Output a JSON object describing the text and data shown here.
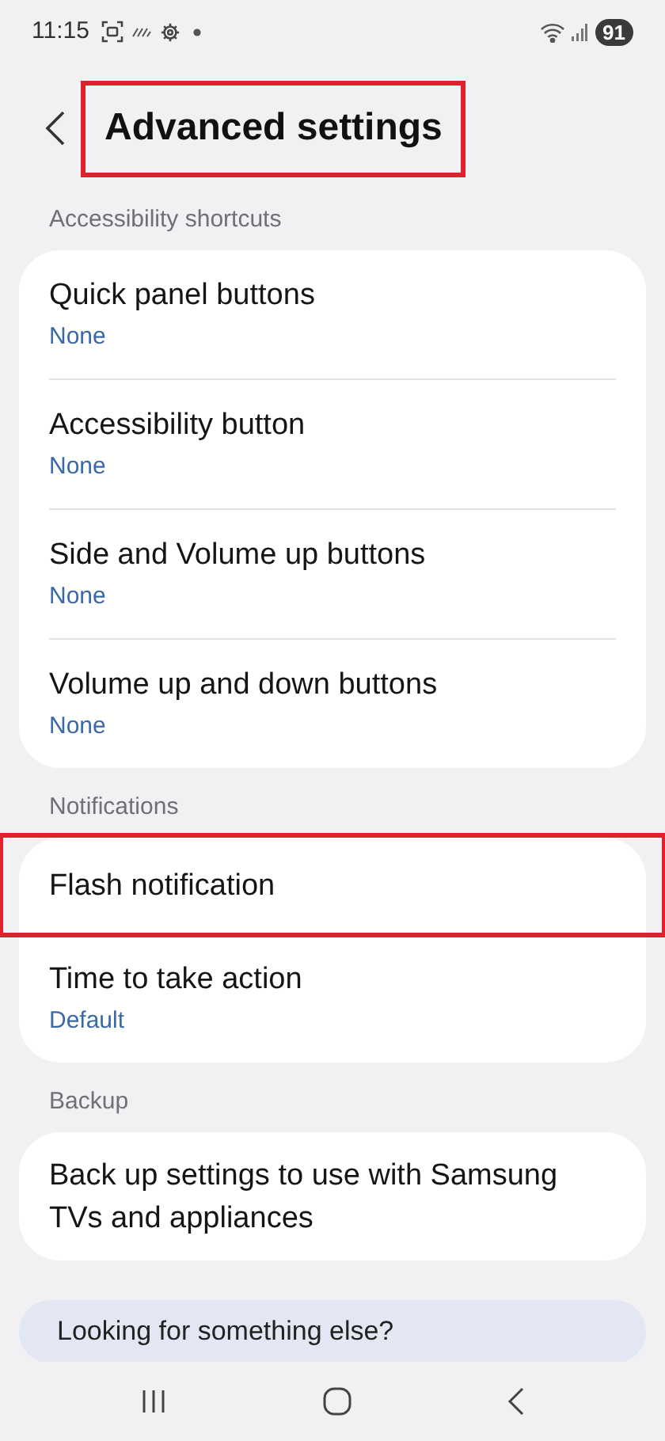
{
  "status_bar": {
    "time": "11:15",
    "battery": "91"
  },
  "header": {
    "title": "Advanced settings",
    "highlighted": true
  },
  "sections": [
    {
      "label": "Accessibility shortcuts",
      "items": [
        {
          "title": "Quick panel buttons",
          "value": "None",
          "highlighted": false
        },
        {
          "title": "Accessibility button",
          "value": "None",
          "highlighted": false
        },
        {
          "title": "Side and Volume up buttons",
          "value": "None",
          "highlighted": false
        },
        {
          "title": "Volume up and down buttons",
          "value": "None",
          "highlighted": false
        }
      ]
    },
    {
      "label": "Notifications",
      "items": [
        {
          "title": "Flash notification",
          "highlighted": true
        },
        {
          "title": "Time to take action",
          "value": "Default",
          "highlighted": false
        }
      ]
    },
    {
      "label": "Backup",
      "items": [
        {
          "title": "Back up settings to use with Samsung TVs and appliances",
          "highlighted": false
        }
      ]
    }
  ],
  "suggestion": {
    "title": "Looking for something else?"
  }
}
